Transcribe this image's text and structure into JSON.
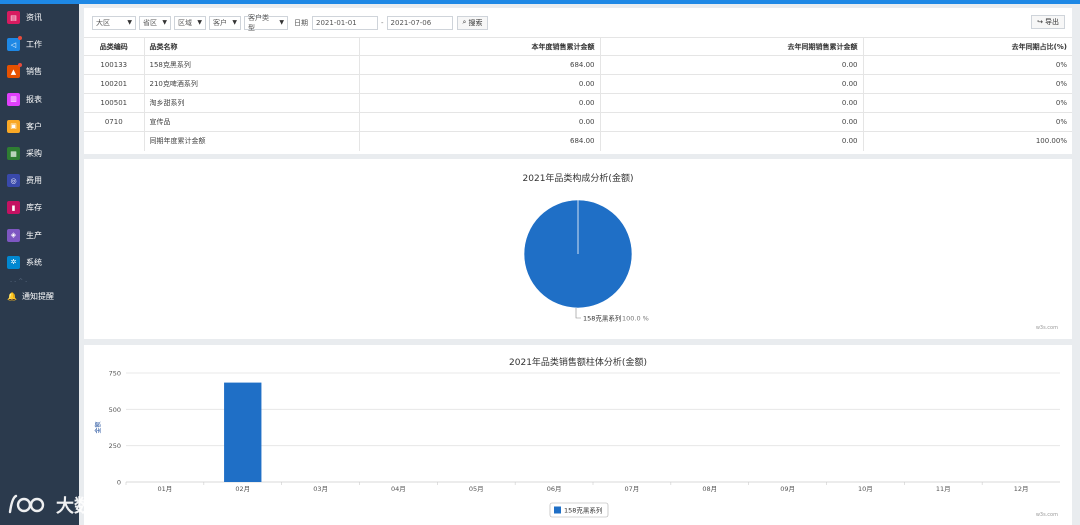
{
  "sidebar": {
    "items": [
      {
        "label": "资讯",
        "icon": "document-icon",
        "color": "#d81b60",
        "glyph": "▤",
        "badge": false
      },
      {
        "label": "工作",
        "icon": "share-icon",
        "color": "#1e88e5",
        "glyph": "◁",
        "badge": true
      },
      {
        "label": "销售",
        "icon": "shop-icon",
        "color": "#e65100",
        "glyph": "▲",
        "badge": true
      },
      {
        "label": "报表",
        "icon": "bar-chart-icon",
        "color": "#e040fb",
        "glyph": "▥",
        "badge": false
      },
      {
        "label": "客户",
        "icon": "gift-icon",
        "color": "#f9a825",
        "glyph": "▣",
        "badge": false
      },
      {
        "label": "采购",
        "icon": "cart-icon",
        "color": "#2e7d32",
        "glyph": "▦",
        "badge": false
      },
      {
        "label": "费用",
        "icon": "money-icon",
        "color": "#3949ab",
        "glyph": "◎",
        "badge": false
      },
      {
        "label": "库存",
        "icon": "clipboard-icon",
        "color": "#c51162",
        "glyph": "▮",
        "badge": false
      },
      {
        "label": "生产",
        "icon": "cube-icon",
        "color": "#7e57c2",
        "glyph": "◈",
        "badge": false
      },
      {
        "label": "系统",
        "icon": "cogs-icon",
        "color": "#0288d1",
        "glyph": "✲",
        "badge": false
      }
    ],
    "separator": "- - ^ -",
    "notify": "通知提醒"
  },
  "watermark": {
    "text": "大数跨境"
  },
  "filters": {
    "selects": [
      "大区",
      "省区",
      "区域",
      "客户",
      "客户类型"
    ],
    "date_label": "日期",
    "date_from": "2021-01-01",
    "date_sep": "-",
    "date_to": "2021-07-06",
    "search_label": "搜索",
    "export_label": "导出"
  },
  "table": {
    "headers": [
      "品类编码",
      "品类名称",
      "本年度销售累计金额",
      "去年同期销售累计金额",
      "去年同期占比(%)"
    ],
    "rows": [
      [
        "100133",
        "158克黑系列",
        "684.00",
        "0.00",
        "0%"
      ],
      [
        "100201",
        "210克啤酒系列",
        "0.00",
        "0.00",
        "0%"
      ],
      [
        "100501",
        "淘乡甜系列",
        "0.00",
        "0.00",
        "0%"
      ],
      [
        "0710",
        "宣传品",
        "0.00",
        "0.00",
        "0%"
      ],
      [
        "",
        "同期年度累计金额",
        "684.00",
        "0.00",
        "100.00%"
      ]
    ]
  },
  "pie_chart": {
    "title": "2021年品类构成分析(金额)",
    "credit": "w3s.com",
    "chart_data": {
      "type": "pie",
      "title": "2021年品类构成分析(金额)",
      "slices": [
        {
          "label": "158克黑系列",
          "percent_label": "100.0 %",
          "value": 100.0
        }
      ],
      "color": "#1f6fc6"
    }
  },
  "bar_chart": {
    "title": "2021年品类销售额柱体分析(金额)",
    "credit": "w3s.com",
    "chart_data": {
      "type": "bar",
      "title": "2021年品类销售额柱体分析(金额)",
      "ylabel": "金额",
      "categories": [
        "01月",
        "02月",
        "03月",
        "04月",
        "05月",
        "06月",
        "07月",
        "08月",
        "09月",
        "10月",
        "11月",
        "12月"
      ],
      "series": [
        {
          "name": "158克黑系列",
          "values": [
            0,
            684,
            0,
            0,
            0,
            0,
            0,
            0,
            0,
            0,
            0,
            0
          ],
          "color": "#1f6fc6"
        }
      ],
      "yticks": [
        0,
        250,
        500,
        750
      ],
      "ylim": [
        0,
        750
      ],
      "grid": true,
      "legend": "bottom-center"
    }
  }
}
